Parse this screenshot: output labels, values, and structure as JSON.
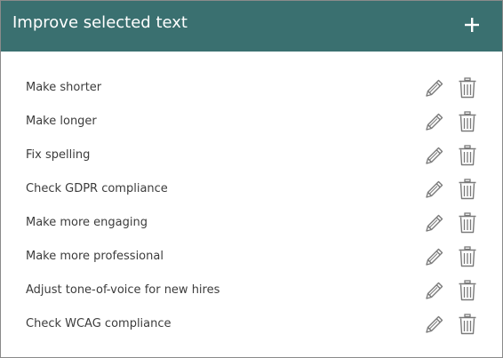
{
  "header": {
    "title": "Improve selected text",
    "add_icon": "plus-icon"
  },
  "items": [
    {
      "label": "Make shorter"
    },
    {
      "label": "Make longer"
    },
    {
      "label": "Fix spelling"
    },
    {
      "label": "Check GDPR compliance"
    },
    {
      "label": "Make more engaging"
    },
    {
      "label": "Make more professional"
    },
    {
      "label": "Adjust tone-of-voice for new hires"
    },
    {
      "label": "Check WCAG compliance"
    }
  ],
  "row_icons": {
    "edit": "pencil-icon",
    "delete": "trash-icon"
  },
  "colors": {
    "header_bg": "#3a7070",
    "header_text": "#ffffff",
    "icon_stroke": "#7a7a7a",
    "label_text": "#3c3c3c"
  }
}
